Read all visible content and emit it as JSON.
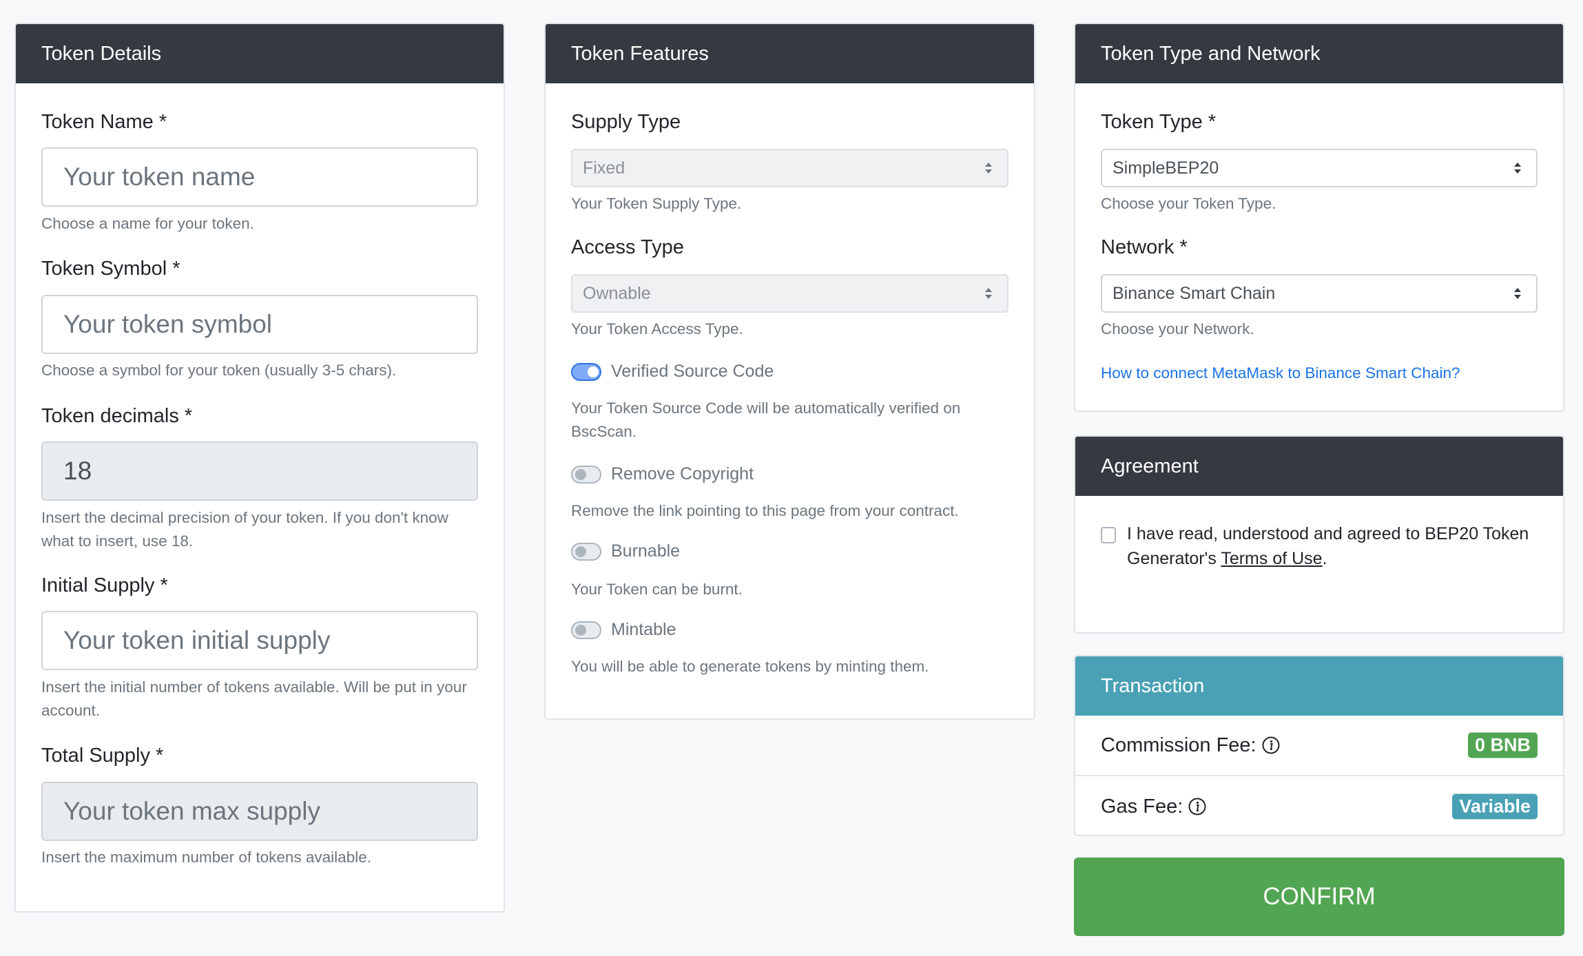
{
  "token_details": {
    "title": "Token Details",
    "name": {
      "label": "Token Name *",
      "placeholder": "Your token name",
      "help": "Choose a name for your token."
    },
    "symbol": {
      "label": "Token Symbol *",
      "placeholder": "Your token symbol",
      "help": "Choose a symbol for your token (usually 3-5 chars)."
    },
    "decimals": {
      "label": "Token decimals *",
      "value": "18",
      "help": "Insert the decimal precision of your token. If you don't know what to insert, use 18."
    },
    "initial_supply": {
      "label": "Initial Supply *",
      "placeholder": "Your token initial supply",
      "help": "Insert the initial number of tokens available. Will be put in your account."
    },
    "total_supply": {
      "label": "Total Supply *",
      "placeholder": "Your token max supply",
      "help": "Insert the maximum number of tokens available."
    }
  },
  "token_features": {
    "title": "Token Features",
    "supply_type": {
      "label": "Supply Type",
      "value": "Fixed",
      "help": "Your Token Supply Type."
    },
    "access_type": {
      "label": "Access Type",
      "value": "Ownable",
      "help": "Your Token Access Type."
    },
    "toggles": [
      {
        "label": "Verified Source Code",
        "checked": true,
        "help": "Your Token Source Code will be automatically verified on BscScan."
      },
      {
        "label": "Remove Copyright",
        "checked": false,
        "help": "Remove the link pointing to this page from your contract."
      },
      {
        "label": "Burnable",
        "checked": false,
        "help": "Your Token can be burnt."
      },
      {
        "label": "Mintable",
        "checked": false,
        "help": "You will be able to generate tokens by minting them."
      }
    ]
  },
  "token_type_network": {
    "title": "Token Type and Network",
    "token_type": {
      "label": "Token Type *",
      "value": "SimpleBEP20",
      "help": "Choose your Token Type."
    },
    "network": {
      "label": "Network *",
      "value": "Binance Smart Chain",
      "help": "Choose your Network."
    },
    "metamask_link": "How to connect MetaMask to Binance Smart Chain?"
  },
  "agreement": {
    "title": "Agreement",
    "text_before": "I have read, understood and agreed to BEP20 Token Generator's ",
    "terms_link": "Terms of Use",
    "text_after": ".",
    "checked": false
  },
  "transaction": {
    "title": "Transaction",
    "commission_label": "Commission Fee:",
    "commission_value": "0 BNB",
    "gas_label": "Gas Fee:",
    "gas_value": "Variable"
  },
  "colors": {
    "header_dark": "#343a40",
    "header_info": "#4aa0b5",
    "success": "#52a552",
    "info_badge": "#4aa0b5",
    "link": "#1a73e8"
  },
  "confirm_label": "CONFIRM"
}
